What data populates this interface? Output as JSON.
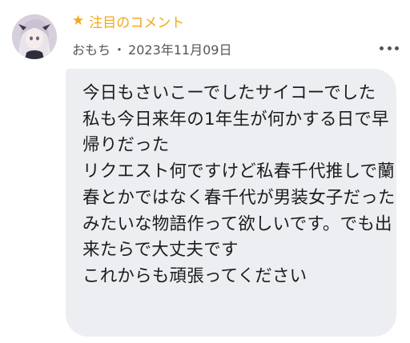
{
  "comment": {
    "featured_label": "注目のコメント",
    "star_icon": "★",
    "author": "おもち",
    "separator": "・",
    "date": "2023年11月09日",
    "more_icon": "more-horizontal-icon",
    "body": "今日もさいこーでしたサイコーでした\n私も今日来年の1年生が何かする日で早帰りだった\nリクエスト何ですけど私春千代推しで蘭春とかではなく春千代が男装女子だったみたいな物語作って欲しいです。でも出来たらで大丈夫です\nこれからも頑張ってください"
  },
  "colors": {
    "accent": "#f2a71b",
    "bubble": "#edeef2",
    "text": "#1c1c1c",
    "meta": "#555555"
  }
}
